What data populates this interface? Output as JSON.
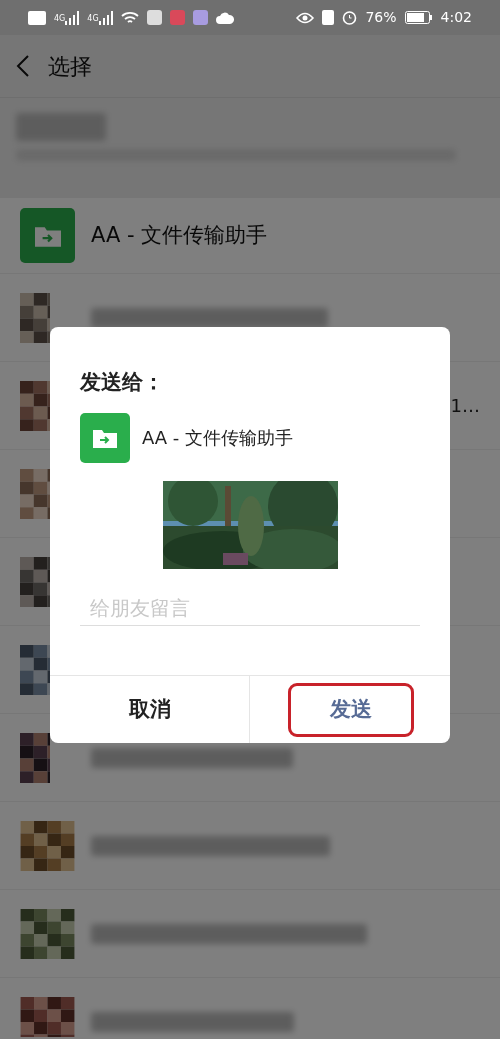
{
  "status_bar": {
    "network": [
      "4G",
      "4G"
    ],
    "battery": "76%",
    "time": "4:02"
  },
  "header": {
    "title": "选择"
  },
  "list": [
    {
      "kind": "contact",
      "title": "AA - 文件传输助手"
    },
    {
      "kind": "blurred"
    },
    {
      "kind": "blurred",
      "tail": "1…"
    },
    {
      "kind": "blurred"
    },
    {
      "kind": "blurred"
    },
    {
      "kind": "blurred"
    },
    {
      "kind": "blurred"
    },
    {
      "kind": "blurred"
    },
    {
      "kind": "blurred"
    },
    {
      "kind": "blurred"
    }
  ],
  "dialog": {
    "title": "发送给：",
    "recipient": "AA - 文件传输助手",
    "message": {
      "placeholder": "给朋友留言"
    },
    "buttons": [
      {
        "label": "取消",
        "kind": "cancel",
        "highlighted": false
      },
      {
        "label": "发送",
        "kind": "primary",
        "highlighted": true
      }
    ]
  }
}
